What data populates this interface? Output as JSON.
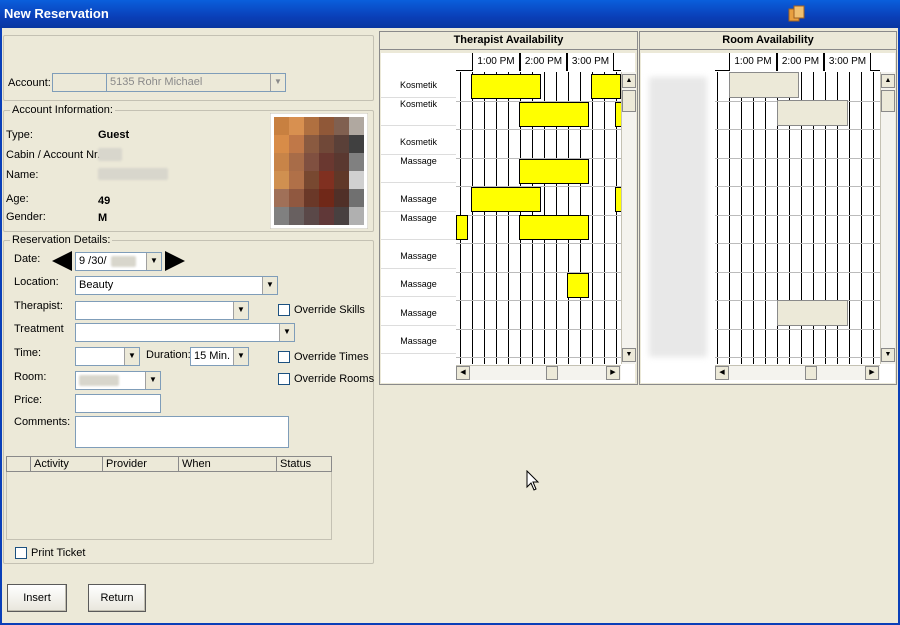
{
  "window": {
    "title": "New Reservation"
  },
  "account": {
    "label": "Account:",
    "value": "5135  Rohr Michael"
  },
  "account_info": {
    "title": "Account Information:",
    "type_label": "Type:",
    "type_value": "Guest",
    "cabin_label": "Cabin / Account Nr.:",
    "name_label": "Name:",
    "age_label": "Age:",
    "age_value": "49",
    "gender_label": "Gender:",
    "gender_value": "M"
  },
  "reservation": {
    "title": "Reservation Details:",
    "date_label": "Date:",
    "date_value": "9 /30/",
    "location_label": "Location:",
    "location_value": "Beauty",
    "therapist_label": "Therapist:",
    "treatment_label": "Treatment",
    "time_label": "Time:",
    "duration_label": "Duration:",
    "duration_value": "15 Min.",
    "room_label": "Room:",
    "price_label": "Price:",
    "comments_label": "Comments:",
    "override_skills": "Override Skills",
    "override_times": "Override Times",
    "override_rooms": "Override Rooms"
  },
  "activity_table": {
    "columns": [
      "Activity",
      "Provider",
      "When",
      "Status"
    ]
  },
  "print_ticket": "Print Ticket",
  "buttons": {
    "insert": "Insert",
    "return": "Return"
  },
  "therapist_panel": {
    "title": "Therapist Availability",
    "times": [
      "1:00 PM",
      "2:00 PM",
      "3:00 PM"
    ],
    "rows": [
      "Kosmetik",
      "Kosmetik",
      "Kosmetik",
      "Massage",
      "Massage",
      "Massage",
      "Massage",
      "Massage",
      "Massage",
      "Massage"
    ]
  },
  "room_panel": {
    "title": "Room Availability",
    "times": [
      "1:00 PM",
      "2:00 PM",
      "3:00 PM"
    ]
  },
  "colors": {
    "booked": "#ffff00",
    "title_bar": "#0a4fd0",
    "background": "#ece9d8"
  }
}
